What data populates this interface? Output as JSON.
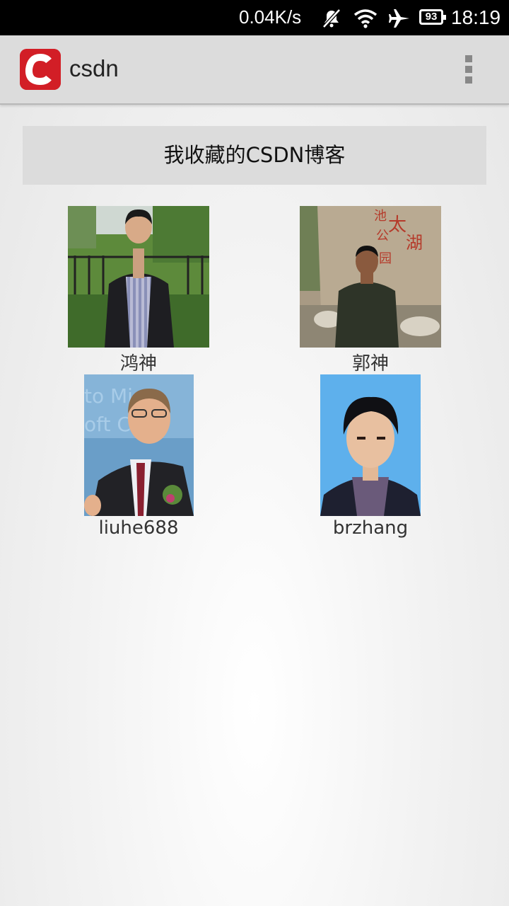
{
  "status_bar": {
    "network_speed": "0.04K/s",
    "battery_level": "93",
    "time": "18:19",
    "icons": [
      "notifications-muted-icon",
      "wifi-icon",
      "airplane-icon",
      "battery-icon"
    ]
  },
  "action_bar": {
    "app_name": "csdn",
    "logo_letter": "C",
    "logo_color": "#d21e26",
    "overflow_icon": "overflow-menu-icon"
  },
  "header": {
    "title": "我收藏的CSDN博客"
  },
  "blogs": [
    {
      "name": "鸿神",
      "photo": "person-photo"
    },
    {
      "name": "郭神",
      "photo": "person-photo"
    },
    {
      "name": "liuhe688",
      "photo": "person-photo"
    },
    {
      "name": "brzhang",
      "photo": "person-photo"
    }
  ]
}
